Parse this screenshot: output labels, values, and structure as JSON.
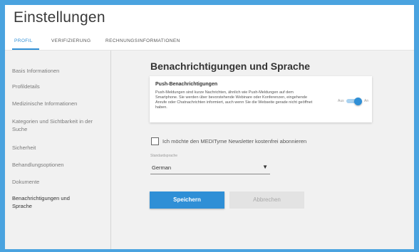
{
  "header": {
    "title": "Einstellungen",
    "tabs": [
      {
        "label": "PROFIL",
        "active": true
      },
      {
        "label": "VERIFIZIERUNG",
        "active": false
      },
      {
        "label": "RECHNUNGSINFORMATIONEN",
        "active": false
      }
    ]
  },
  "sidebar": {
    "items": [
      {
        "label": "Basis Informationen",
        "active": false
      },
      {
        "label": "Profildetails",
        "active": false
      },
      {
        "label": "Medizinische Informationen",
        "active": false
      },
      {
        "label": "Kategorien und Sichtbarkeit in der Suche",
        "active": false
      },
      {
        "label": "Sicherheit",
        "active": false
      },
      {
        "label": "Behandlungsoptionen",
        "active": false
      },
      {
        "label": "Dokumente",
        "active": false
      },
      {
        "label": "Benachrichtigungen und Sprache",
        "active": true
      }
    ]
  },
  "main": {
    "section_title": "Benachrichtigungen und Sprache",
    "push": {
      "title": "Push-Benachrichtigungen",
      "description": "Push-Meldungen sind kurze Nachrichten, ähnlich wie Push-Meldungen auf dem Smartphone. Sie werden über bevorstehende Webinare oder Konferenzen, eingehende Anrufe oder Chatnachrichten informiert, auch wenn Sie die Webseite gerade nicht geöffnet haben.",
      "toggle_off_label": "Aus",
      "toggle_on_label": "An",
      "enabled": true
    },
    "newsletter": {
      "label": "Ich möchte den MEDITyme Newsletter kostenfrei abonnieren",
      "checked": false
    },
    "language": {
      "label": "Standardsprache",
      "value": "German"
    },
    "buttons": {
      "save_label": "Speichern",
      "cancel_label": "Abbrechen"
    }
  },
  "colors": {
    "accent": "#2f8fd6",
    "frame": "#4aa3df"
  }
}
